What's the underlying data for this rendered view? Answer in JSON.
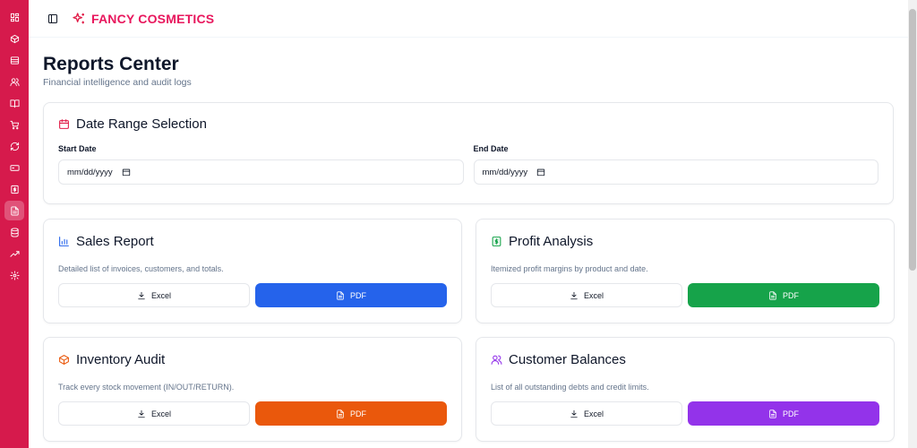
{
  "brand": {
    "name": "FANCY COSMETICS",
    "color": "#e8175d"
  },
  "sidebar": {
    "color": "#d61a4c",
    "items": [
      {
        "icon": "dashboard-icon",
        "active": false
      },
      {
        "icon": "box-icon",
        "active": false
      },
      {
        "icon": "archive-icon",
        "active": false
      },
      {
        "icon": "users-icon",
        "active": false
      },
      {
        "icon": "book-icon",
        "active": false
      },
      {
        "icon": "cart-icon",
        "active": false
      },
      {
        "icon": "refresh-icon",
        "active": false
      },
      {
        "icon": "wallet-icon",
        "active": false
      },
      {
        "icon": "dollar-note-icon",
        "active": false
      },
      {
        "icon": "file-text-icon",
        "active": true
      },
      {
        "icon": "database-icon",
        "active": false
      },
      {
        "icon": "trending-up-icon",
        "active": false
      },
      {
        "icon": "settings-icon",
        "active": false
      }
    ]
  },
  "page": {
    "title": "Reports Center",
    "subtitle": "Financial intelligence and audit logs"
  },
  "date_range": {
    "title": "Date Range Selection",
    "icon": "calendar-icon",
    "icon_color": "#e11d48",
    "start": {
      "label": "Start Date",
      "value": "mm/dd/yyyy"
    },
    "end": {
      "label": "End Date",
      "value": "mm/dd/yyyy"
    }
  },
  "reports": [
    {
      "id": "sales",
      "title": "Sales Report",
      "icon": "bar-chart-icon",
      "accent": "#2563eb",
      "description": "Detailed list of invoices, customers, and totals.",
      "excel_label": "Excel",
      "pdf_label": "PDF"
    },
    {
      "id": "profit",
      "title": "Profit Analysis",
      "icon": "dollar-box-icon",
      "accent": "#16a34a",
      "description": "Itemized profit margins by product and date.",
      "excel_label": "Excel",
      "pdf_label": "PDF"
    },
    {
      "id": "inventory",
      "title": "Inventory Audit",
      "icon": "package-icon",
      "accent": "#ea580c",
      "description": "Track every stock movement (IN/OUT/RETURN).",
      "excel_label": "Excel",
      "pdf_label": "PDF"
    },
    {
      "id": "customers",
      "title": "Customer Balances",
      "icon": "users-icon",
      "accent": "#9333ea",
      "description": "List of all outstanding debts and credit limits.",
      "excel_label": "Excel",
      "pdf_label": "PDF"
    }
  ]
}
